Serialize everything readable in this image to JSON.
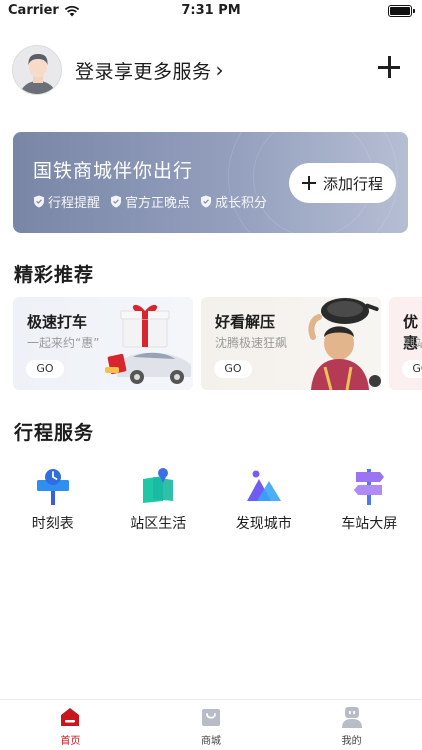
{
  "status_bar": {
    "carrier": "Carrier",
    "time": "7:31 PM",
    "battery_level": 1.0
  },
  "profile": {
    "login_text": "登录享更多服务",
    "chevron": "›"
  },
  "banner": {
    "title": "国铁商城伴你出行",
    "tags": [
      "行程提醒",
      "官方正晚点",
      "成长积分"
    ],
    "add_trip_label": "添加行程"
  },
  "recommend": {
    "title": "精彩推荐",
    "cards": [
      {
        "title": "极速打车",
        "subtitle": "一起来约“惠”",
        "button": "GO"
      },
      {
        "title": "好看解压",
        "subtitle": "沈腾极速狂飙",
        "button": "GO"
      },
      {
        "title": "优惠",
        "subtitle": "到站",
        "button": "GO"
      }
    ]
  },
  "trip_services": {
    "title": "行程服务",
    "items": [
      {
        "label": "时刻表",
        "icon": "timetable-icon"
      },
      {
        "label": "站区生活",
        "icon": "station-life-icon"
      },
      {
        "label": "发现城市",
        "icon": "discover-city-icon"
      },
      {
        "label": "车站大屏",
        "icon": "station-screen-icon"
      }
    ]
  },
  "tabbar": {
    "tabs": [
      {
        "label": "首页",
        "icon": "home-icon",
        "active": true
      },
      {
        "label": "商城",
        "icon": "shop-bag-icon",
        "active": false
      },
      {
        "label": "我的",
        "icon": "profile-icon",
        "active": false
      }
    ]
  },
  "colors": {
    "accent": "#c8161d",
    "banner_start": "#7a86a6",
    "banner_end": "#b5bed3"
  }
}
